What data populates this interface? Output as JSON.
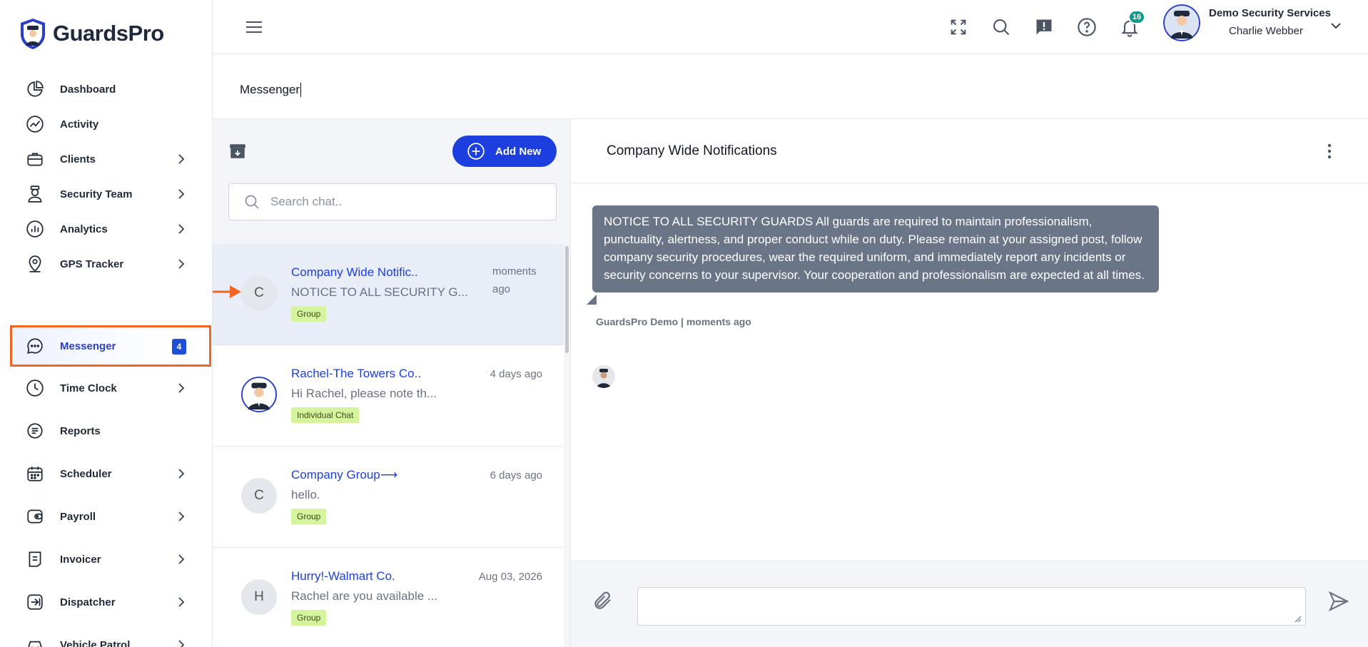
{
  "app": {
    "logo_text": "GuardsPro"
  },
  "sidebar": {
    "items": [
      {
        "label": "Dashboard",
        "icon": "pie-chart-icon",
        "has_chevron": false
      },
      {
        "label": "Activity",
        "icon": "activity-chart-icon",
        "has_chevron": false
      },
      {
        "label": "Clients",
        "icon": "briefcase-icon",
        "has_chevron": true
      },
      {
        "label": "Security Team",
        "icon": "guard-icon",
        "has_chevron": true
      },
      {
        "label": "Analytics",
        "icon": "bar-chart-icon",
        "has_chevron": true
      },
      {
        "label": "GPS Tracker",
        "icon": "map-pin-icon",
        "has_chevron": true
      },
      {
        "label": "Messenger",
        "icon": "chat-bubble-icon",
        "has_chevron": false,
        "badge": "4",
        "active": true
      },
      {
        "label": "Time Clock",
        "icon": "clock-icon",
        "has_chevron": true
      },
      {
        "label": "Reports",
        "icon": "document-icon",
        "has_chevron": false
      },
      {
        "label": "Scheduler",
        "icon": "calendar-icon",
        "has_chevron": true
      },
      {
        "label": "Payroll",
        "icon": "wallet-icon",
        "has_chevron": true
      },
      {
        "label": "Invoicer",
        "icon": "invoice-icon",
        "has_chevron": true
      },
      {
        "label": "Dispatcher",
        "icon": "dispatch-icon",
        "has_chevron": true
      },
      {
        "label": "Vehicle Patrol",
        "icon": "car-icon",
        "has_chevron": true
      }
    ]
  },
  "topbar": {
    "notification_count": "16",
    "company_name": "Demo Security Services",
    "user_name": "Charlie Webber"
  },
  "page": {
    "title": "Messenger"
  },
  "chat_list": {
    "add_new_label": "Add New",
    "search_placeholder": "Search chat..",
    "items": [
      {
        "avatar": "C",
        "name": "Company Wide Notific..",
        "preview": "NOTICE TO ALL SECURITY G...",
        "time": "moments ago",
        "tag": "Group",
        "selected": true
      },
      {
        "avatar": "",
        "name": "Rachel-The Towers Co..",
        "preview": "Hi Rachel, please note th...",
        "time": "4 days ago",
        "tag": "Individual Chat",
        "selected": false
      },
      {
        "avatar": "C",
        "name": "Company Group⟶",
        "preview": "hello.",
        "time": "6 days ago",
        "tag": "Group",
        "selected": false
      },
      {
        "avatar": "H",
        "name": "Hurry!-Walmart Co.",
        "preview": "Rachel are you available ...",
        "time": "Aug 03, 2026",
        "tag": "Group",
        "selected": false
      }
    ]
  },
  "conversation": {
    "title": "Company Wide Notifications",
    "message": {
      "text": "NOTICE TO ALL SECURITY GUARDS All guards are required to maintain professionalism, punctuality, alertness, and proper conduct while on duty. Please remain at your assigned post, follow company security procedures, wear the required uniform, and immediately report any incidents or security concerns to your supervisor. Your cooperation and professionalism are expected at all times.",
      "meta": "GuardsPro Demo | moments ago"
    },
    "composer_value": ""
  },
  "colors": {
    "accent": "#1d3fe0",
    "highlight_outline": "#f26522",
    "bubble": "#6b7588",
    "tag": "#d4f59d",
    "notification_badge": "#0f9b8e"
  }
}
